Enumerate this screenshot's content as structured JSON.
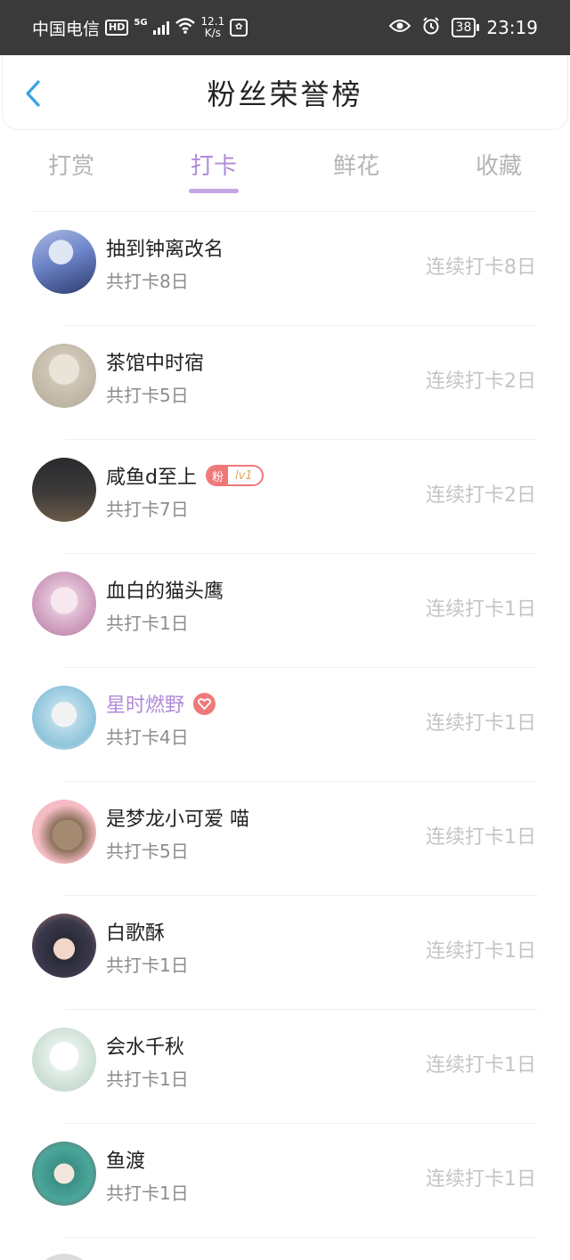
{
  "status_bar": {
    "carrier": "中国电信",
    "hd": "HD",
    "network": "5G",
    "speed_value": "12.1",
    "speed_unit": "K/s",
    "battery": "38",
    "time": "23:19"
  },
  "header": {
    "title": "粉丝荣誉榜"
  },
  "tabs": [
    {
      "label": "打赏",
      "active": false
    },
    {
      "label": "打卡",
      "active": true
    },
    {
      "label": "鲜花",
      "active": false
    },
    {
      "label": "收藏",
      "active": false
    }
  ],
  "fans": [
    {
      "name": "抽到钟离改名",
      "total": "共打卡8日",
      "streak": "连续打卡8日"
    },
    {
      "name": "茶馆中时宿",
      "total": "共打卡5日",
      "streak": "连续打卡2日"
    },
    {
      "name": "咸鱼d至上",
      "total": "共打卡7日",
      "streak": "连续打卡2日",
      "badge_tag": "粉",
      "badge_level": "lv1"
    },
    {
      "name": "血白的猫头鹰",
      "total": "共打卡1日",
      "streak": "连续打卡1日"
    },
    {
      "name": "星时燃野",
      "total": "共打卡4日",
      "streak": "连续打卡1日",
      "vip": true
    },
    {
      "name": "是梦龙小可爱 喵",
      "total": "共打卡5日",
      "streak": "连续打卡1日"
    },
    {
      "name": "白歌酥",
      "total": "共打卡1日",
      "streak": "连续打卡1日"
    },
    {
      "name": "会水千秋",
      "total": "共打卡1日",
      "streak": "连续打卡1日"
    },
    {
      "name": "鱼渡",
      "total": "共打卡1日",
      "streak": "连续打卡1日"
    }
  ],
  "colors": {
    "accent": "#b28ad9",
    "status_bar_bg": "#3a3a3a",
    "back_arrow": "#3aa0e8",
    "badge_red": "#f07777"
  }
}
